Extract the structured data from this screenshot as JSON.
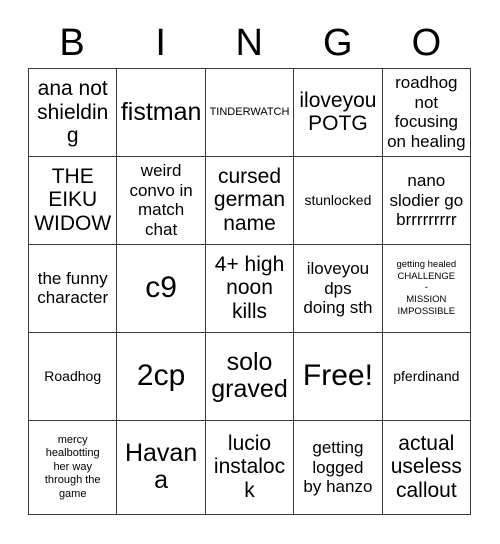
{
  "card": {
    "header_letters": [
      "B",
      "I",
      "N",
      "G",
      "O"
    ],
    "free_space_label": "Free!",
    "rows": [
      [
        {
          "text": "ana not\nshielding",
          "size": "lg"
        },
        {
          "text": "fistman",
          "size": "xl"
        },
        {
          "text": "TINDERWATCH",
          "size": "xs"
        },
        {
          "text": "iloveyou\nPOTG",
          "size": "lg"
        },
        {
          "text": "roadhog\nnot\nfocusing\non healing",
          "size": "md"
        }
      ],
      [
        {
          "text": "THE\nEIKU\nWIDOW",
          "size": "lg"
        },
        {
          "text": "weird\nconvo in\nmatch\nchat",
          "size": "md"
        },
        {
          "text": "cursed\ngerman\nname",
          "size": "lg"
        },
        {
          "text": "stunlocked",
          "size": "sm"
        },
        {
          "text": "nano\nslodier go\nbrrrrrrrrr",
          "size": "md"
        }
      ],
      [
        {
          "text": "the funny\ncharacter",
          "size": "md"
        },
        {
          "text": "c9",
          "size": "xxl"
        },
        {
          "text": "4+ high\nnoon\nkills",
          "size": "lg"
        },
        {
          "text": "iloveyou\ndps\ndoing sth",
          "size": "md"
        },
        {
          "text": "getting healed\nCHALLENGE\n-\nMISSION\nIMPOSSIBLE",
          "size": "xxs"
        }
      ],
      [
        {
          "text": "Roadhog",
          "size": "sm"
        },
        {
          "text": "2cp",
          "size": "xxl"
        },
        {
          "text": "solo\ngraved",
          "size": "xl"
        },
        {
          "text": "Free!",
          "size": "xxl"
        },
        {
          "text": "pferdinand",
          "size": "sm"
        }
      ],
      [
        {
          "text": "mercy\nhealbotting\nher way\nthrough the\ngame",
          "size": "xs"
        },
        {
          "text": "Havana",
          "size": "xl"
        },
        {
          "text": "lucio\ninstalock",
          "size": "lg"
        },
        {
          "text": "getting\nlogged\nby hanzo",
          "size": "md"
        },
        {
          "text": "actual\nuseless\ncallout",
          "size": "lg"
        }
      ]
    ]
  },
  "colors": {
    "background": "#ffffff",
    "border": "#3a3a3a",
    "text": "#000000"
  }
}
